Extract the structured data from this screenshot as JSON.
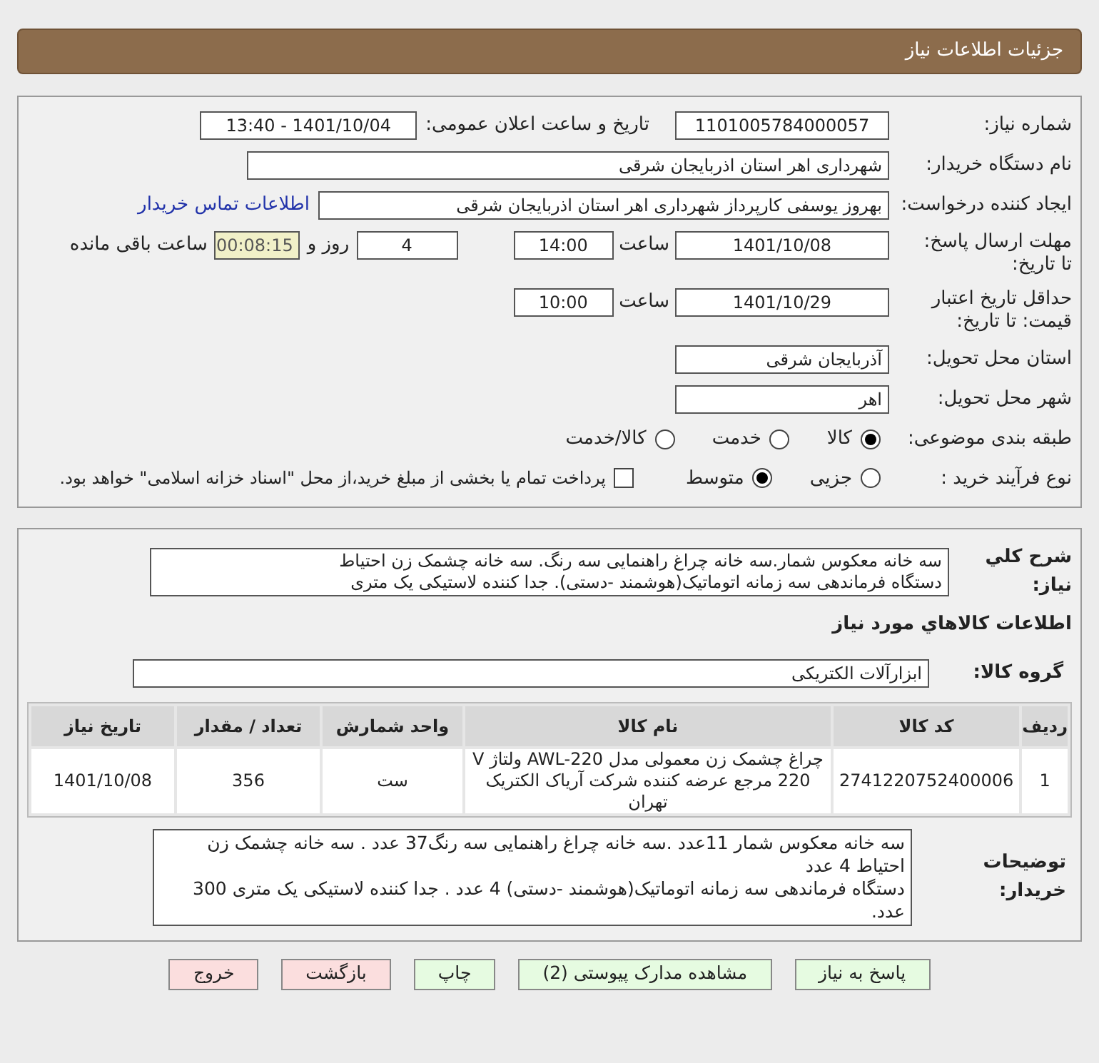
{
  "header": {
    "title": "جزئیات اطلاعات نیاز"
  },
  "need_number": {
    "label": "شماره نیاز:",
    "value": "1101005784000057"
  },
  "announce": {
    "label": "تاریخ و ساعت اعلان عمومی:",
    "value": "1401/10/04 - 13:40"
  },
  "buyer": {
    "label": "نام دستگاه خریدار:",
    "value": "شهرداری اهر استان اذربایجان شرقی"
  },
  "requester": {
    "label": "ایجاد کننده درخواست:",
    "value": "بهروز یوسفی کارپرداز شهرداری اهر استان اذربایجان شرقی",
    "link": "اطلاعات تماس خریدار"
  },
  "deadline": {
    "label": "مهلت ارسال پاسخ: تا تاریخ:",
    "date": "1401/10/08",
    "time_label": "ساعت",
    "time": "14:00",
    "days": "4",
    "days_label": "روز و",
    "remaining": "00:08:15",
    "remaining_label": "ساعت باقی مانده"
  },
  "validity": {
    "label": "حداقل تاریخ اعتبار قیمت: تا تاریخ:",
    "date": "1401/10/29",
    "time_label": "ساعت",
    "time": "10:00"
  },
  "province": {
    "label": "استان محل تحویل:",
    "value": "آذربایجان شرقی"
  },
  "city": {
    "label": "شهر محل تحویل:",
    "value": "اهر"
  },
  "category": {
    "label": "طبقه بندی موضوعی:",
    "options": [
      {
        "label": "کالا",
        "selected": true
      },
      {
        "label": "خدمت",
        "selected": false
      },
      {
        "label": "کالا/خدمت",
        "selected": false
      }
    ]
  },
  "process": {
    "label": "نوع فرآیند خرید :",
    "options": [
      {
        "label": "جزیی",
        "selected": false
      },
      {
        "label": "متوسط",
        "selected": true
      }
    ],
    "checkbox": {
      "label": "پرداخت تمام یا بخشی از مبلغ خرید،از محل \"اسناد خزانه اسلامی\" خواهد بود.",
      "checked": false
    }
  },
  "description": {
    "label": "شرح کلي نياز:",
    "lines": [
      "سه خانه معکوس شمار.سه خانه چراغ راهنمایی سه رنگ. سه خانه چشمک زن احتیاط",
      "دستگاه فرماندهی سه زمانه اتوماتیک(هوشمند -دستی). جدا کننده لاستیکی یک متری"
    ]
  },
  "goods_title": "اطلاعات کالاهاي مورد نياز",
  "group": {
    "label": "گروه کالا:",
    "value": "ابزارآلات الکتریکی"
  },
  "table": {
    "columns": [
      "ردیف",
      "کد کالا",
      "نام کالا",
      "واحد شمارش",
      "تعداد / مقدار",
      "تاریخ نیاز"
    ],
    "rows": [
      [
        "1",
        "2741220752400006",
        "چراغ چشمک زن معمولی مدل AWL-220 ولتاژ V 220 مرجع عرضه کننده شرکت آریاک الکتریک تهران",
        "ست",
        "356",
        "1401/10/08"
      ]
    ]
  },
  "buyer_notes": {
    "label": "توضیحات خریدار:",
    "paragraphs": [
      "سه خانه معکوس شمار 11عدد .سه خانه چراغ راهنمایی سه رنگ37 عدد . سه خانه چشمک زن احتیاط 4 عدد",
      "دستگاه فرماندهی سه زمانه اتوماتیک(هوشمند -دستی) 4 عدد . جدا کننده لاستیکی یک متری 300 عدد."
    ]
  },
  "buttons": [
    {
      "label": "پاسخ به نیاز",
      "kind": "normal"
    },
    {
      "label": "مشاهده مدارک پیوستی (2)",
      "kind": "normal"
    },
    {
      "label": "چاپ",
      "kind": "normal"
    },
    {
      "label": "بازگشت",
      "kind": "danger"
    },
    {
      "label": "خروج",
      "kind": "danger"
    }
  ]
}
